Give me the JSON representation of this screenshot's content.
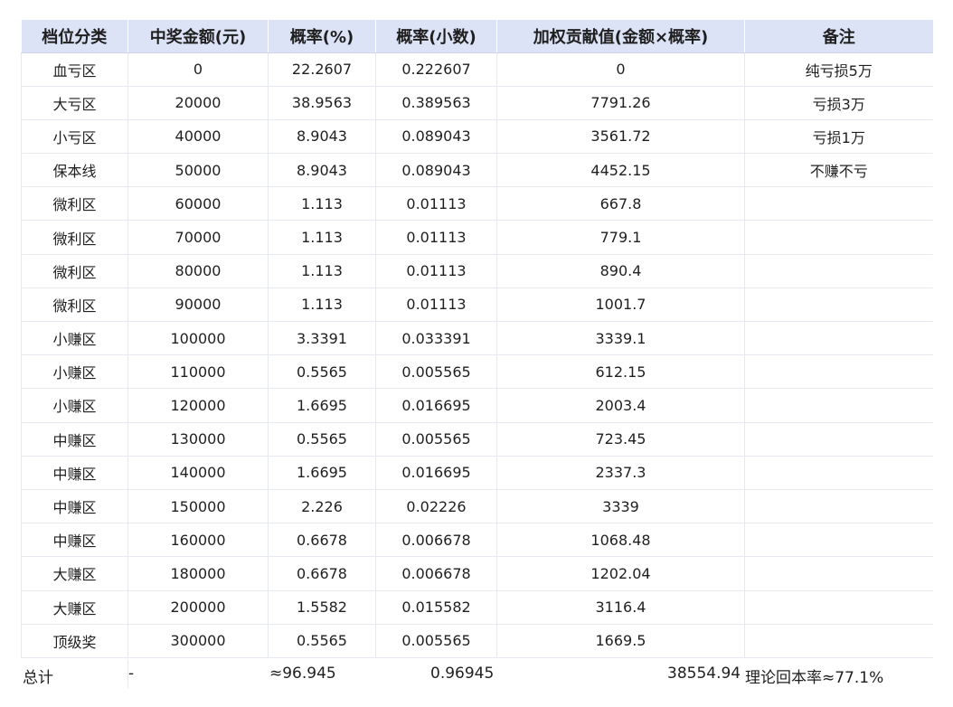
{
  "headers": [
    "档位分类",
    "中奖金额(元)",
    "概率(%)",
    "概率(小数)",
    "加权贡献值(金额×概率)",
    "备注"
  ],
  "rows": [
    {
      "tier": "血亏区",
      "amount": "0",
      "pct": "22.2607",
      "dec": "0.222607",
      "weight": "0",
      "note": "纯亏损5万"
    },
    {
      "tier": "大亏区",
      "amount": "20000",
      "pct": "38.9563",
      "dec": "0.389563",
      "weight": "7791.26",
      "note": "亏损3万"
    },
    {
      "tier": "小亏区",
      "amount": "40000",
      "pct": "8.9043",
      "dec": "0.089043",
      "weight": "3561.72",
      "note": "亏损1万"
    },
    {
      "tier": "保本线",
      "amount": "50000",
      "pct": "8.9043",
      "dec": "0.089043",
      "weight": "4452.15",
      "note": "不赚不亏"
    },
    {
      "tier": "微利区",
      "amount": "60000",
      "pct": "1.113",
      "dec": "0.01113",
      "weight": "667.8",
      "note": ""
    },
    {
      "tier": "微利区",
      "amount": "70000",
      "pct": "1.113",
      "dec": "0.01113",
      "weight": "779.1",
      "note": ""
    },
    {
      "tier": "微利区",
      "amount": "80000",
      "pct": "1.113",
      "dec": "0.01113",
      "weight": "890.4",
      "note": ""
    },
    {
      "tier": "微利区",
      "amount": "90000",
      "pct": "1.113",
      "dec": "0.01113",
      "weight": "1001.7",
      "note": ""
    },
    {
      "tier": "小赚区",
      "amount": "100000",
      "pct": "3.3391",
      "dec": "0.033391",
      "weight": "3339.1",
      "note": ""
    },
    {
      "tier": "小赚区",
      "amount": "110000",
      "pct": "0.5565",
      "dec": "0.005565",
      "weight": "612.15",
      "note": ""
    },
    {
      "tier": "小赚区",
      "amount": "120000",
      "pct": "1.6695",
      "dec": "0.016695",
      "weight": "2003.4",
      "note": ""
    },
    {
      "tier": "中赚区",
      "amount": "130000",
      "pct": "0.5565",
      "dec": "0.005565",
      "weight": "723.45",
      "note": ""
    },
    {
      "tier": "中赚区",
      "amount": "140000",
      "pct": "1.6695",
      "dec": "0.016695",
      "weight": "2337.3",
      "note": ""
    },
    {
      "tier": "中赚区",
      "amount": "150000",
      "pct": "2.226",
      "dec": "0.02226",
      "weight": "3339",
      "note": ""
    },
    {
      "tier": "中赚区",
      "amount": "160000",
      "pct": "0.6678",
      "dec": "0.006678",
      "weight": "1068.48",
      "note": ""
    },
    {
      "tier": "大赚区",
      "amount": "180000",
      "pct": "0.6678",
      "dec": "0.006678",
      "weight": "1202.04",
      "note": ""
    },
    {
      "tier": "大赚区",
      "amount": "200000",
      "pct": "1.5582",
      "dec": "0.015582",
      "weight": "3116.4",
      "note": ""
    },
    {
      "tier": "顶级奖",
      "amount": "300000",
      "pct": "0.5565",
      "dec": "0.005565",
      "weight": "1669.5",
      "note": ""
    }
  ],
  "total": {
    "label": "总计",
    "amount": "-",
    "pct": "≈96.945",
    "dec": "0.96945",
    "weight": "38554.94",
    "note": "理论回本率≈77.1%"
  },
  "colors": {
    "header_bg": "#dde3f6",
    "grid_line": "#e6e9ef",
    "text": "#1f1f1f"
  }
}
